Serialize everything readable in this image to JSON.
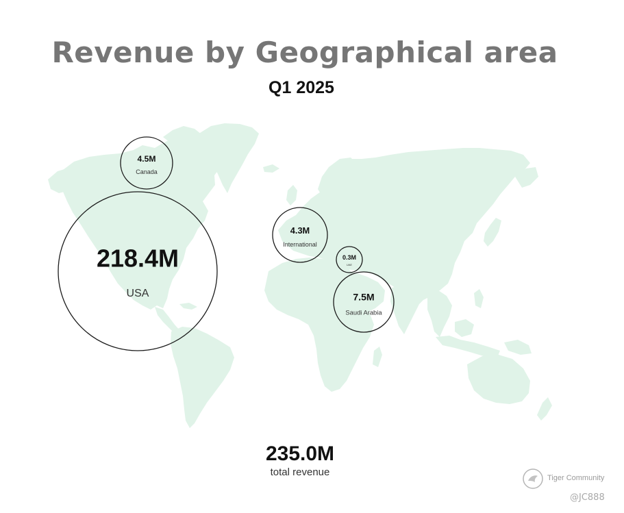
{
  "chart_data": {
    "type": "bubble-map",
    "title": "Revenue by Geographical area",
    "subtitle": "Q1 2025",
    "unit": "M",
    "regions": [
      {
        "name": "USA",
        "value": 218.4,
        "display": "218.4M"
      },
      {
        "name": "Saudi Arabia",
        "value": 7.5,
        "display": "7.5M"
      },
      {
        "name": "Canada",
        "value": 4.5,
        "display": "4.5M"
      },
      {
        "name": "International",
        "value": 4.3,
        "display": "4.3M"
      },
      {
        "name": "UAE",
        "value": 0.3,
        "display": "0.3M"
      }
    ],
    "total": {
      "value": 235.0,
      "display": "235.0M",
      "label": "total revenue"
    }
  },
  "colors": {
    "land": "#e0f3e8",
    "bubble_stroke": "#1b1b1b",
    "title": "#767676",
    "text": "#111111"
  },
  "watermark": {
    "brand": "Tiger Community",
    "handle": "@JC888"
  }
}
